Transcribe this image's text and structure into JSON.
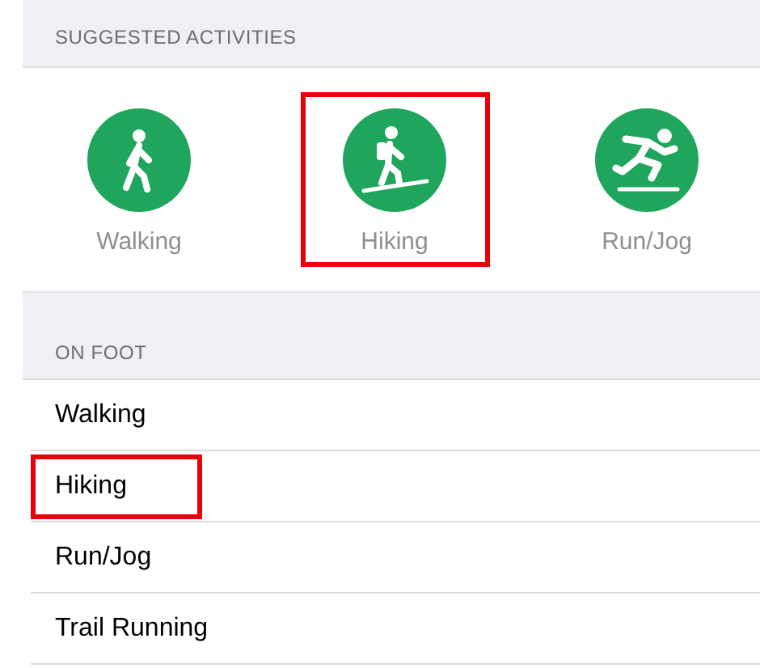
{
  "suggested_header": "SUGGESTED ACTIVITIES",
  "suggested_activities": [
    {
      "label": "Walking",
      "kind": "walk",
      "highlighted": false
    },
    {
      "label": "Hiking",
      "kind": "hike",
      "highlighted": true
    },
    {
      "label": "Run/Jog",
      "kind": "run",
      "highlighted": false
    }
  ],
  "on_foot_header": "ON FOOT",
  "on_foot_items": [
    {
      "label": "Walking",
      "highlighted": false
    },
    {
      "label": "Hiking",
      "highlighted": true
    },
    {
      "label": "Run/Jog",
      "highlighted": false
    },
    {
      "label": "Trail Running",
      "highlighted": false
    }
  ]
}
